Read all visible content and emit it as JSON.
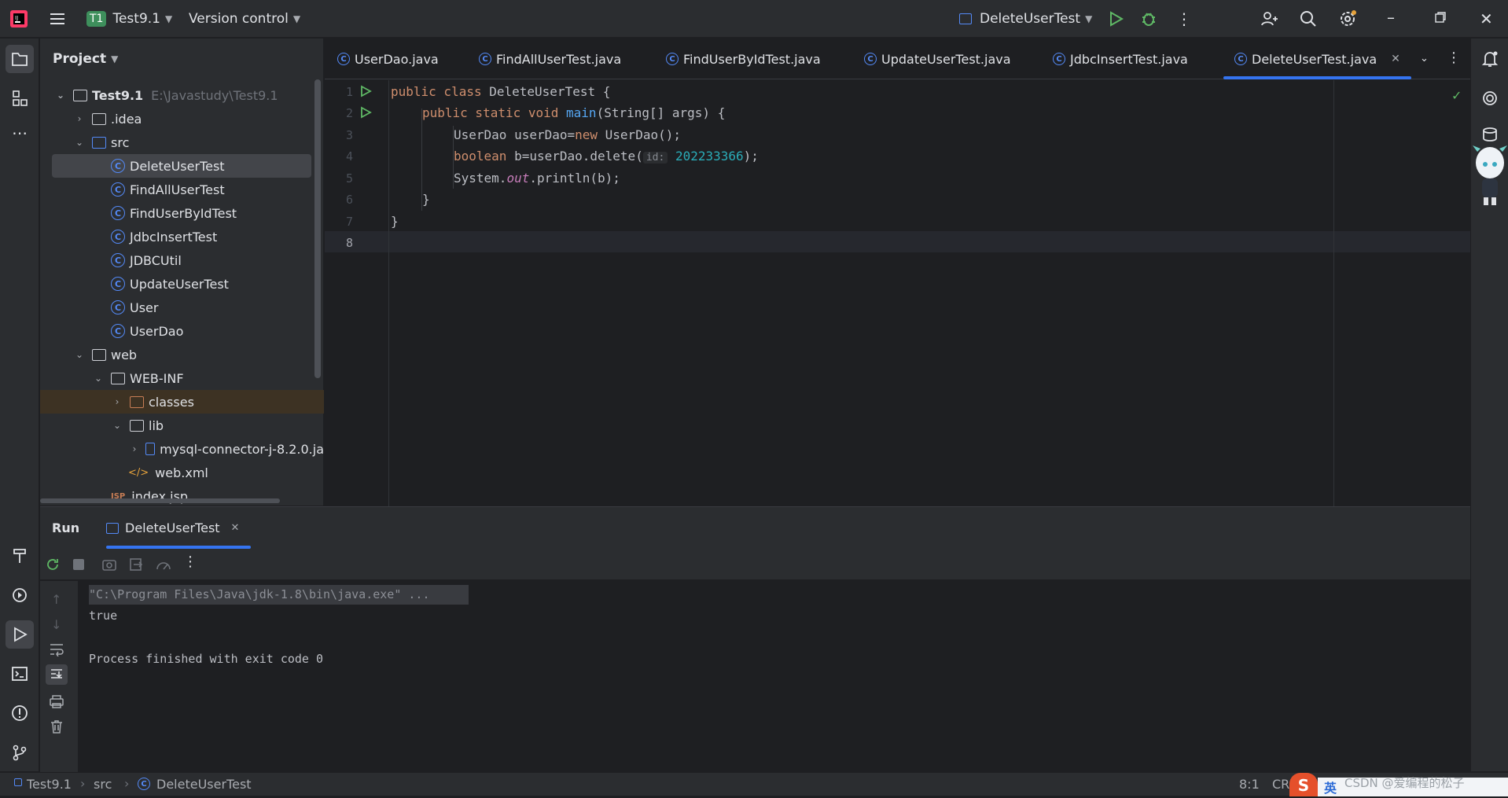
{
  "titlebar": {
    "project_badge": "T1",
    "project_name": "Test9.1",
    "vcs": "Version control",
    "run_config": "DeleteUserTest"
  },
  "project_panel": {
    "title": "Project",
    "tree": [
      {
        "label": "Test9.1",
        "path": "E:\\Javastudy\\Test9.1",
        "type": "module"
      },
      {
        "label": ".idea",
        "type": "folder"
      },
      {
        "label": "src",
        "type": "folder"
      },
      {
        "label": "DeleteUserTest",
        "type": "class"
      },
      {
        "label": "FindAllUserTest",
        "type": "class"
      },
      {
        "label": "FindUserByIdTest",
        "type": "class"
      },
      {
        "label": "JdbcInsertTest",
        "type": "class"
      },
      {
        "label": "JDBCUtil",
        "type": "class"
      },
      {
        "label": "UpdateUserTest",
        "type": "class"
      },
      {
        "label": "User",
        "type": "class"
      },
      {
        "label": "UserDao",
        "type": "class"
      },
      {
        "label": "web",
        "type": "folder"
      },
      {
        "label": "WEB-INF",
        "type": "folder"
      },
      {
        "label": "classes",
        "type": "folder-excluded"
      },
      {
        "label": "lib",
        "type": "folder"
      },
      {
        "label": "mysql-connector-j-8.2.0.ja",
        "type": "jar"
      },
      {
        "label": "web.xml",
        "type": "xml"
      },
      {
        "label": "index.jsp",
        "type": "jsp"
      }
    ]
  },
  "tabs": [
    {
      "label": "UserDao.java"
    },
    {
      "label": "FindAllUserTest.java"
    },
    {
      "label": "FindUserByIdTest.java"
    },
    {
      "label": "UpdateUserTest.java"
    },
    {
      "label": "JdbcInsertTest.java"
    },
    {
      "label": "DeleteUserTest.java",
      "active": true
    }
  ],
  "editor": {
    "line_numbers": [
      "1",
      "2",
      "3",
      "4",
      "5",
      "6",
      "7",
      "8"
    ],
    "lines": {
      "l1_kw": "public class ",
      "l1_rest": "DeleteUserTest {",
      "l2_kw": "public static void ",
      "l2_fn": "main",
      "l2_rest": "(String[] args) {",
      "l3_a": "UserDao userDao=",
      "l3_kw": "new ",
      "l3_b": "UserDao();",
      "l4_kw": "boolean ",
      "l4_a": "b=userDao.delete(",
      "l4_hint": "id:",
      "l4_num": "202233366",
      "l4_b": ");",
      "l5_a": "System.",
      "l5_st": "out",
      "l5_b": ".println(b);",
      "l6": "}",
      "l7": "}"
    }
  },
  "run_panel": {
    "title": "Run",
    "tab": "DeleteUserTest",
    "console": [
      "\"C:\\Program Files\\Java\\jdk-1.8\\bin\\java.exe\" ...",
      "true",
      "",
      "Process finished with exit code 0"
    ]
  },
  "statusbar": {
    "crumbs": [
      "Test9.1",
      "src",
      "DeleteUserTest"
    ],
    "position": "8:1",
    "line_sep": "CR",
    "watermark": "CSDN @爱编程的松子",
    "ime": "英"
  }
}
